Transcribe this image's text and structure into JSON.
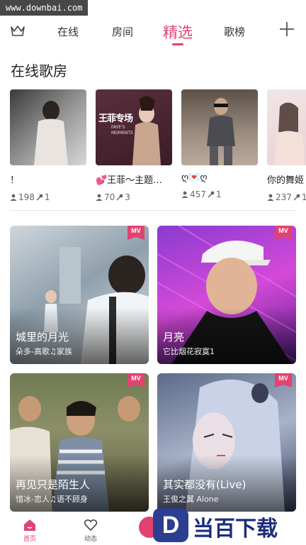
{
  "watermark": "www.downbai.com",
  "tabs": [
    {
      "label": "在线"
    },
    {
      "label": "房间"
    },
    {
      "label": "精选",
      "active": true
    },
    {
      "label": "歌榜"
    }
  ],
  "section": {
    "title": "在线歌房"
  },
  "rooms": [
    {
      "name": "！",
      "listeners": "198",
      "mics": "1"
    },
    {
      "name": "💕王菲～主题...",
      "listeners": "70",
      "mics": "3"
    },
    {
      "name": "ღ💌ღ",
      "listeners": "457",
      "mics": "1"
    },
    {
      "name": "你的舞姬",
      "listeners": "237",
      "mics": "1"
    }
  ],
  "room_cover_text": {
    "line1": "王菲专场",
    "line2": "FAYE'S MOMENTS"
  },
  "mvs": [
    {
      "badge": "MV",
      "title": "城里的月光",
      "subtitle": "朵多-高歌♫家族"
    },
    {
      "badge": "MV",
      "title": "月亮",
      "subtitle": "它比烟花寂寞1"
    },
    {
      "badge": "MV",
      "title": "再见只是陌生人",
      "subtitle": "惜冰-恋人♫语不顾身"
    },
    {
      "badge": "MV",
      "title": "其实都没有(Live)",
      "subtitle": "王俊之翼 Alone"
    }
  ],
  "bottom_nav": [
    {
      "label": "首页",
      "active": true
    },
    {
      "label": "动态"
    }
  ],
  "brand": {
    "letter": "D",
    "text": "当百下载"
  },
  "colors": {
    "accent": "#e0436f",
    "brand": "#1d2d7a"
  }
}
